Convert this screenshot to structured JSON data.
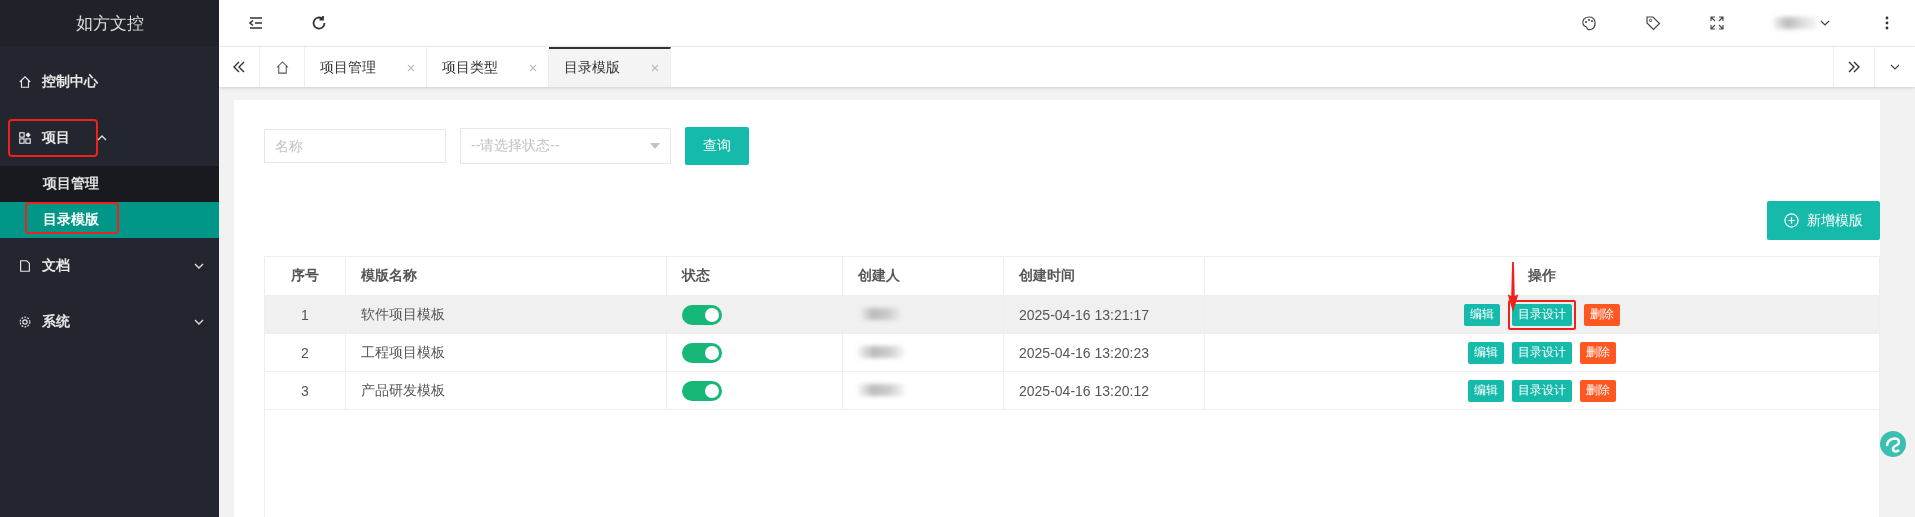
{
  "sidebar": {
    "title": "如方文控",
    "items": [
      {
        "label": "控制中心",
        "highlighted": false
      },
      {
        "label": "项目",
        "highlighted": true,
        "expanded": true,
        "children": [
          {
            "label": "项目管理",
            "selected": false,
            "highlighted": false
          },
          {
            "label": "目录模版",
            "selected": true,
            "highlighted": true
          }
        ]
      },
      {
        "label": "文档",
        "highlighted": false,
        "expanded": false
      },
      {
        "label": "系统",
        "highlighted": false,
        "expanded": false
      }
    ]
  },
  "tabs": [
    {
      "label": "项目管理",
      "selected": false
    },
    {
      "label": "项目类型",
      "selected": false
    },
    {
      "label": "目录模版",
      "selected": true
    }
  ],
  "filters": {
    "name": {
      "placeholder": "名称"
    },
    "status": {
      "placeholder": "--请选择状态--"
    },
    "search_button": "查询"
  },
  "add_button": "新增模版",
  "table": {
    "columns": [
      "序号",
      "模版名称",
      "状态",
      "创建人",
      "创建时间",
      "操作"
    ],
    "rows": [
      {
        "index": "1",
        "name": "软件项目模板",
        "on": true,
        "created": "2025-04-16 13:21:17",
        "selected": true,
        "actions": [
          {
            "label": "编辑",
            "kind": "edit",
            "highlighted": false
          },
          {
            "label": "目录设计",
            "kind": "design",
            "highlighted": true
          },
          {
            "label": "删除",
            "kind": "delete",
            "highlighted": false
          }
        ]
      },
      {
        "index": "2",
        "name": "工程项目模板",
        "on": true,
        "created": "2025-04-16 13:20:23",
        "selected": false,
        "actions": [
          {
            "label": "编辑",
            "kind": "edit",
            "highlighted": false
          },
          {
            "label": "目录设计",
            "kind": "design",
            "highlighted": false
          },
          {
            "label": "删除",
            "kind": "delete",
            "highlighted": false
          }
        ]
      },
      {
        "index": "3",
        "name": "产品研发模板",
        "on": true,
        "created": "2025-04-16 13:20:12",
        "selected": false,
        "actions": [
          {
            "label": "编辑",
            "kind": "edit",
            "highlighted": false
          },
          {
            "label": "目录设计",
            "kind": "design",
            "highlighted": false
          },
          {
            "label": "删除",
            "kind": "delete",
            "highlighted": false
          }
        ]
      }
    ]
  }
}
